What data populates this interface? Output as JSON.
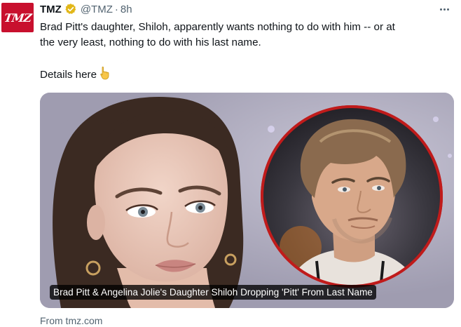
{
  "tweet": {
    "avatar_logo": "TMZ",
    "display_name": "TMZ",
    "handle": "@TMZ",
    "separator": "·",
    "time": "8h",
    "text_line1": "Brad Pitt's daughter, Shiloh, apparently wants nothing to do with him -- or at",
    "text_line2": "the very least, nothing to do with his last name.",
    "details": "Details here",
    "details_emoji": "pointing-down-hand",
    "card_caption": "Brad Pitt & Angelina Jolie's Daughter Shiloh Dropping 'Pitt' From Last Name",
    "source": "From tmz.com"
  },
  "colors": {
    "brand_red": "#c8102e",
    "verified_gold": "#e2b719",
    "secondary_text": "#536471",
    "text": "#0f1419"
  }
}
